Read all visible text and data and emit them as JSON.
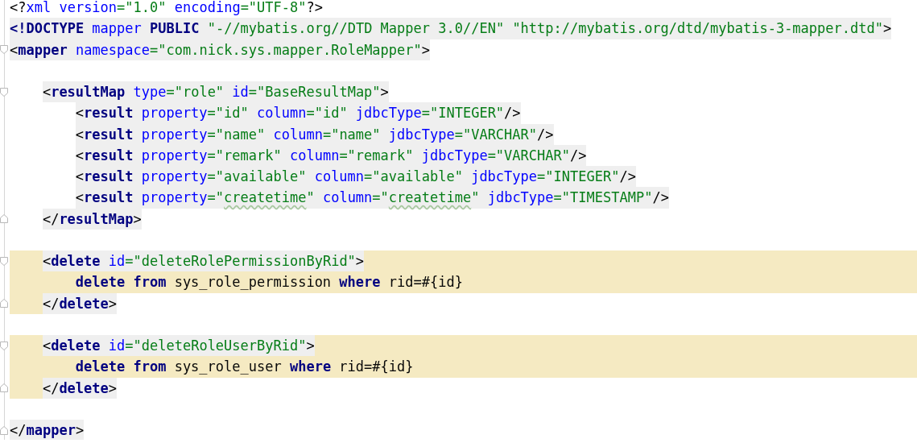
{
  "nodes": [
    {
      "kind": "line",
      "shaded": false,
      "tokens": [
        {
          "kind": "punct",
          "text": "<?"
        },
        {
          "kind": "attr",
          "text": "xml version"
        },
        {
          "kind": "value",
          "text": "=\"1.0\""
        },
        {
          "kind": "attr",
          "text": " encoding"
        },
        {
          "kind": "value",
          "text": "=\"UTF-8\""
        },
        {
          "kind": "punct",
          "text": "?>"
        }
      ]
    },
    {
      "kind": "line",
      "shaded": true,
      "tokens": [
        {
          "kind": "tag",
          "text": "<!DOCTYPE"
        },
        {
          "kind": "attr",
          "text": " mapper"
        },
        {
          "kind": "tag",
          "text": " PUBLIC"
        },
        {
          "kind": "value",
          "text": " \"-//mybatis.org//DTD Mapper 3.0//EN\""
        },
        {
          "kind": "value",
          "text": " \"http://mybatis.org/dtd/mybatis-3-mapper.dtd\""
        },
        {
          "kind": "punct",
          "text": ">"
        }
      ]
    },
    {
      "kind": "element",
      "highlighted": false,
      "open": {
        "shaded": true,
        "tokens": [
          {
            "kind": "punct",
            "text": "<"
          },
          {
            "kind": "tag",
            "text": "mapper"
          },
          {
            "kind": "attr",
            "text": " namespace"
          },
          {
            "kind": "value",
            "text": "=\"com.nick.sys.mapper.RoleMapper\""
          },
          {
            "kind": "punct",
            "text": ">"
          }
        ]
      },
      "children": [
        {
          "kind": "blank"
        },
        {
          "kind": "element",
          "highlighted": false,
          "open": {
            "shaded": true,
            "tokens": [
              {
                "kind": "punct",
                "text": "<"
              },
              {
                "kind": "tag",
                "text": "resultMap"
              },
              {
                "kind": "attr",
                "text": " type"
              },
              {
                "kind": "value",
                "text": "=\"role\""
              },
              {
                "kind": "attr",
                "text": " id"
              },
              {
                "kind": "value",
                "text": "=\"BaseResultMap\""
              },
              {
                "kind": "punct",
                "text": ">"
              }
            ]
          },
          "children": [
            {
              "kind": "line",
              "shaded": true,
              "tokens": [
                {
                  "kind": "punct",
                  "text": "<"
                },
                {
                  "kind": "tag",
                  "text": "result"
                },
                {
                  "kind": "attr",
                  "text": " property"
                },
                {
                  "kind": "value",
                  "text": "=\"id\""
                },
                {
                  "kind": "attr",
                  "text": " column"
                },
                {
                  "kind": "value",
                  "text": "=\"id\""
                },
                {
                  "kind": "attr",
                  "text": " jdbcType"
                },
                {
                  "kind": "value",
                  "text": "=\"INTEGER\""
                },
                {
                  "kind": "punct",
                  "text": "/>"
                }
              ]
            },
            {
              "kind": "line",
              "shaded": true,
              "tokens": [
                {
                  "kind": "punct",
                  "text": "<"
                },
                {
                  "kind": "tag",
                  "text": "result"
                },
                {
                  "kind": "attr",
                  "text": " property"
                },
                {
                  "kind": "value",
                  "text": "=\"name\""
                },
                {
                  "kind": "attr",
                  "text": " column"
                },
                {
                  "kind": "value",
                  "text": "=\"name\""
                },
                {
                  "kind": "attr",
                  "text": " jdbcType"
                },
                {
                  "kind": "value",
                  "text": "=\"VARCHAR\""
                },
                {
                  "kind": "punct",
                  "text": "/>"
                }
              ]
            },
            {
              "kind": "line",
              "shaded": true,
              "tokens": [
                {
                  "kind": "punct",
                  "text": "<"
                },
                {
                  "kind": "tag",
                  "text": "result"
                },
                {
                  "kind": "attr",
                  "text": " property"
                },
                {
                  "kind": "value",
                  "text": "=\"remark\""
                },
                {
                  "kind": "attr",
                  "text": " column"
                },
                {
                  "kind": "value",
                  "text": "=\"remark\""
                },
                {
                  "kind": "attr",
                  "text": " jdbcType"
                },
                {
                  "kind": "value",
                  "text": "=\"VARCHAR\""
                },
                {
                  "kind": "punct",
                  "text": "/>"
                }
              ]
            },
            {
              "kind": "line",
              "shaded": true,
              "tokens": [
                {
                  "kind": "punct",
                  "text": "<"
                },
                {
                  "kind": "tag",
                  "text": "result"
                },
                {
                  "kind": "attr",
                  "text": " property"
                },
                {
                  "kind": "value",
                  "text": "=\"available\""
                },
                {
                  "kind": "attr",
                  "text": " column"
                },
                {
                  "kind": "value",
                  "text": "=\"available\""
                },
                {
                  "kind": "attr",
                  "text": " jdbcType"
                },
                {
                  "kind": "value",
                  "text": "=\"INTEGER\""
                },
                {
                  "kind": "punct",
                  "text": "/>"
                }
              ]
            },
            {
              "kind": "line",
              "shaded": true,
              "tokens": [
                {
                  "kind": "punct",
                  "text": "<"
                },
                {
                  "kind": "tag",
                  "text": "result"
                },
                {
                  "kind": "attr",
                  "text": " property"
                },
                {
                  "kind": "value",
                  "text": "=\""
                },
                {
                  "kind": "typo",
                  "text": "createtime"
                },
                {
                  "kind": "value",
                  "text": "\""
                },
                {
                  "kind": "attr",
                  "text": " column"
                },
                {
                  "kind": "value",
                  "text": "=\""
                },
                {
                  "kind": "typo",
                  "text": "createtime"
                },
                {
                  "kind": "value",
                  "text": "\""
                },
                {
                  "kind": "attr",
                  "text": " jdbcType"
                },
                {
                  "kind": "value",
                  "text": "=\"TIMESTAMP\""
                },
                {
                  "kind": "punct",
                  "text": "/>"
                }
              ]
            }
          ],
          "close": {
            "shaded": true,
            "tokens": [
              {
                "kind": "punct",
                "text": "</"
              },
              {
                "kind": "tag",
                "text": "resultMap"
              },
              {
                "kind": "punct",
                "text": ">"
              }
            ]
          }
        },
        {
          "kind": "blank"
        },
        {
          "kind": "element",
          "highlighted": true,
          "open": {
            "shaded": true,
            "tokens": [
              {
                "kind": "punct",
                "text": "<"
              },
              {
                "kind": "tag",
                "text": "delete"
              },
              {
                "kind": "attr",
                "text": " id"
              },
              {
                "kind": "value",
                "text": "=\"deleteRolePermissionByRid\""
              },
              {
                "kind": "punct",
                "text": ">"
              }
            ]
          },
          "children": [
            {
              "kind": "line",
              "shaded": false,
              "tokens": [
                {
                  "kind": "keyword",
                  "text": "delete"
                },
                {
                  "kind": "keyword",
                  "text": " from"
                },
                {
                  "kind": "text",
                  "text": " sys_role_permission"
                },
                {
                  "kind": "keyword",
                  "text": " where"
                },
                {
                  "kind": "text",
                  "text": " rid=#{id}"
                }
              ]
            }
          ],
          "close": {
            "shaded": true,
            "tokens": [
              {
                "kind": "punct",
                "text": "</"
              },
              {
                "kind": "tag",
                "text": "delete"
              },
              {
                "kind": "punct",
                "text": ">"
              }
            ]
          }
        },
        {
          "kind": "blank"
        },
        {
          "kind": "element",
          "highlighted": true,
          "open": {
            "shaded": true,
            "tokens": [
              {
                "kind": "punct",
                "text": "<"
              },
              {
                "kind": "tag",
                "text": "delete"
              },
              {
                "kind": "attr",
                "text": " id"
              },
              {
                "kind": "value",
                "text": "=\"deleteRoleUserByRid\""
              },
              {
                "kind": "punct",
                "text": ">"
              }
            ]
          },
          "children": [
            {
              "kind": "line",
              "shaded": false,
              "tokens": [
                {
                  "kind": "keyword",
                  "text": "delete"
                },
                {
                  "kind": "keyword",
                  "text": " from"
                },
                {
                  "kind": "text",
                  "text": " sys_role_user"
                },
                {
                  "kind": "keyword",
                  "text": " where"
                },
                {
                  "kind": "text",
                  "text": " rid=#{id}"
                }
              ]
            }
          ],
          "close": {
            "shaded": true,
            "tokens": [
              {
                "kind": "punct",
                "text": "</"
              },
              {
                "kind": "tag",
                "text": "delete"
              },
              {
                "kind": "punct",
                "text": ">"
              }
            ]
          }
        },
        {
          "kind": "blank"
        }
      ],
      "close": {
        "shaded": true,
        "tokens": [
          {
            "kind": "punct",
            "text": "</"
          },
          {
            "kind": "tag",
            "text": "mapper"
          },
          {
            "kind": "punct",
            "text": ">"
          }
        ]
      }
    }
  ]
}
